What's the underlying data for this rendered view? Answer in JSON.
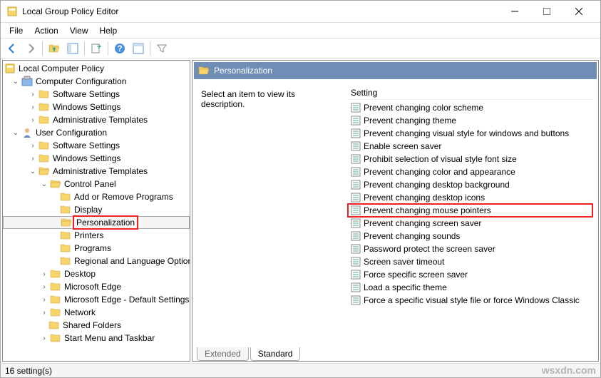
{
  "window": {
    "title": "Local Group Policy Editor"
  },
  "menubar": {
    "file": "File",
    "action": "Action",
    "view": "View",
    "help": "Help"
  },
  "tree": {
    "root": "Local Computer Policy",
    "computer_config": "Computer Configuration",
    "cc_software": "Software Settings",
    "cc_windows": "Windows Settings",
    "cc_admin": "Administrative Templates",
    "user_config": "User Configuration",
    "uc_software": "Software Settings",
    "uc_windows": "Windows Settings",
    "uc_admin": "Administrative Templates",
    "control_panel": "Control Panel",
    "add_remove": "Add or Remove Programs",
    "display": "Display",
    "personalization": "Personalization",
    "printers": "Printers",
    "programs": "Programs",
    "regional": "Regional and Language Options",
    "desktop": "Desktop",
    "ms_edge": "Microsoft Edge",
    "ms_edge_default": "Microsoft Edge - Default Settings",
    "network": "Network",
    "shared_folders": "Shared Folders",
    "start_menu": "Start Menu and Taskbar"
  },
  "detail": {
    "header": "Personalization",
    "description": "Select an item to view its description.",
    "setting_header": "Setting",
    "items": [
      "Prevent changing color scheme",
      "Prevent changing theme",
      "Prevent changing visual style for windows and buttons",
      "Enable screen saver",
      "Prohibit selection of visual style font size",
      "Prevent changing color and appearance",
      "Prevent changing desktop background",
      "Prevent changing desktop icons",
      "Prevent changing mouse pointers",
      "Prevent changing screen saver",
      "Prevent changing sounds",
      "Password protect the screen saver",
      "Screen saver timeout",
      "Force specific screen saver",
      "Load a specific theme",
      "Force a specific visual style file or force Windows Classic"
    ],
    "highlighted_index": 8
  },
  "tabs": {
    "extended": "Extended",
    "standard": "Standard"
  },
  "statusbar": {
    "text": "16 setting(s)"
  },
  "watermark": "wsxdn.com"
}
